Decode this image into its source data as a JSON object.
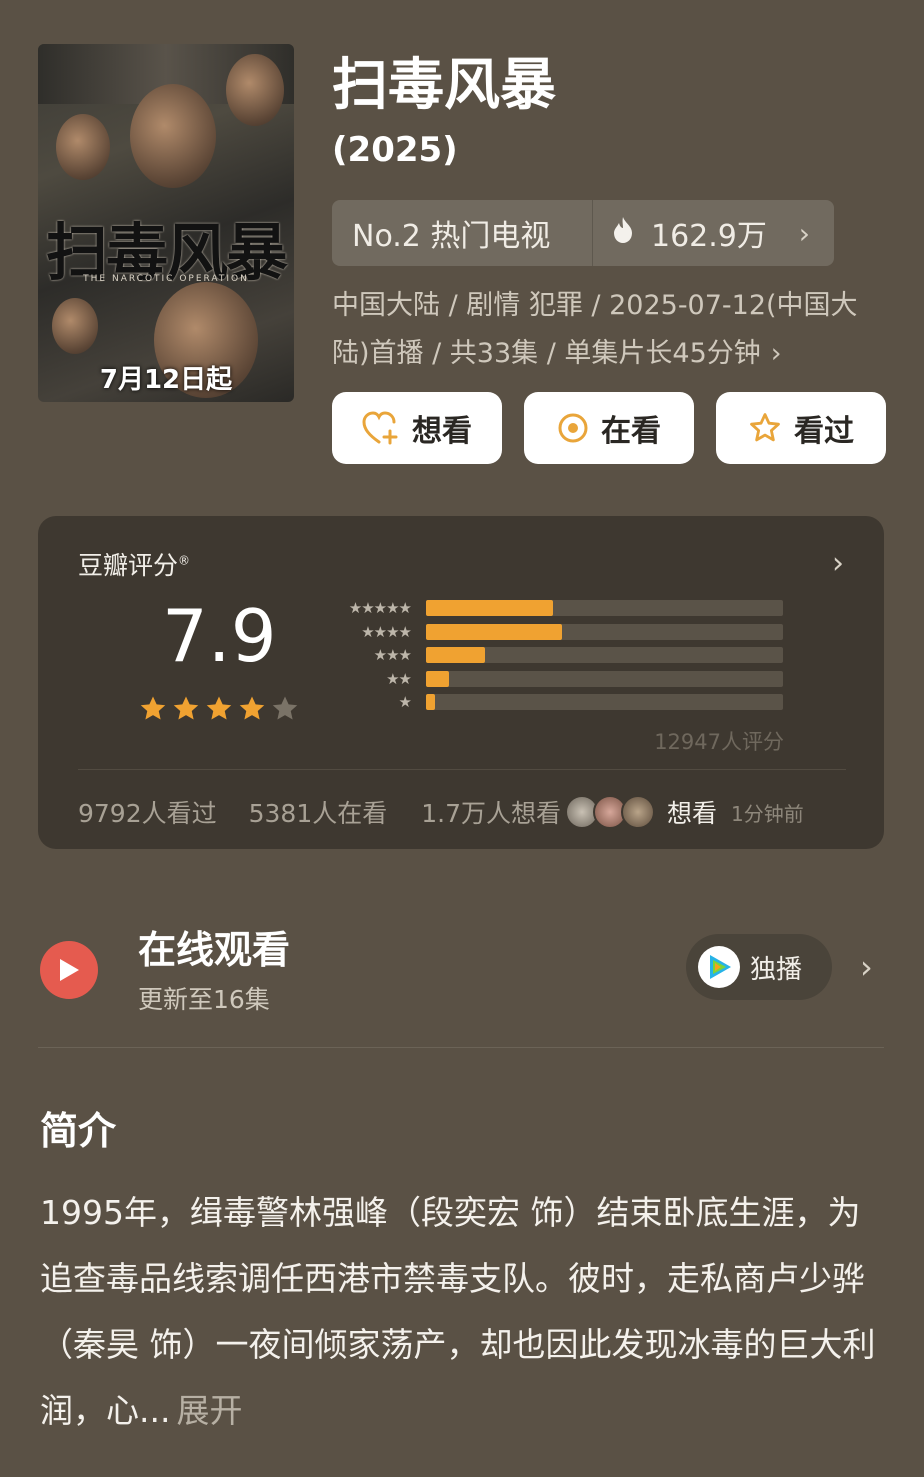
{
  "poster": {
    "title_art": "扫毒风暴",
    "subtitle_art": "THE NARCOTIC OPERATION",
    "date_badge": "7月12日起"
  },
  "show": {
    "title": "扫毒风暴",
    "year": "(2025)"
  },
  "rank": {
    "label": "No.2 热门电视",
    "heat": "162.9万"
  },
  "meta": {
    "text": "中国大陆 / 剧情 犯罪 / 2025-07-12(中国大陆)首播 / 共33集 / 单集片长45分钟"
  },
  "actions": {
    "want": "想看",
    "watching": "在看",
    "watched": "看过"
  },
  "rating": {
    "label": "豆瓣评分",
    "mark": "®",
    "score": "7.9",
    "stars": 4,
    "count_text": "12947人评分",
    "distribution": [
      {
        "stars": 5,
        "fraction": 0.355
      },
      {
        "stars": 4,
        "fraction": 0.38
      },
      {
        "stars": 3,
        "fraction": 0.165
      },
      {
        "stars": 2,
        "fraction": 0.065
      },
      {
        "stars": 1,
        "fraction": 0.025
      }
    ],
    "watched_text": "9792人看过",
    "watching_text": "5381人在看",
    "want_text": "1.7万人想看",
    "recent_action": "想看",
    "recent_time": "1分钟前",
    "accent_color": "#f0a231"
  },
  "online": {
    "title": "在线观看",
    "update": "更新至16集",
    "exclusive_label": "独播"
  },
  "intro": {
    "heading": "简介",
    "body": "1995年，缉毒警林强峰（段奕宏 饰）结束卧底生涯，为追查毒品线索调任西港市禁毒支队。彼时，走私商卢少骅（秦昊 饰）一夜间倾家荡产，却也因此发现冰毒的巨大利润，心...",
    "expand_label": "展开"
  }
}
